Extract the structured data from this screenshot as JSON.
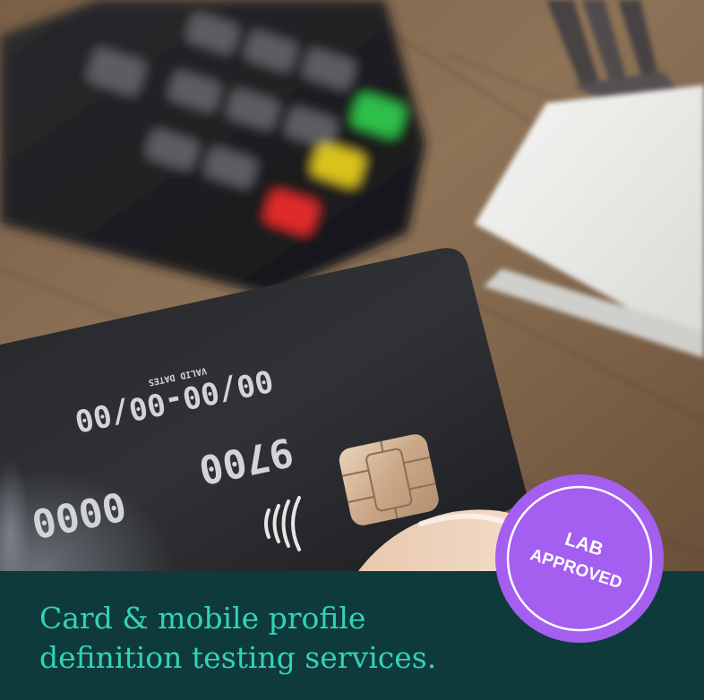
{
  "badge": {
    "line1": "LAB",
    "line2": "APPROVED"
  },
  "headline": {
    "line1": "Card & mobile profile",
    "line2": "definition testing services."
  },
  "card": {
    "dates": "00/00-00/00",
    "dates_caption": "VALID DATES",
    "number_a": "9700",
    "number_b": "0000"
  },
  "colors": {
    "panel": "#0f3a3b",
    "headline_text": "#33d3b6",
    "badge": "#a45ef0",
    "badge_text": "#ffffff"
  }
}
